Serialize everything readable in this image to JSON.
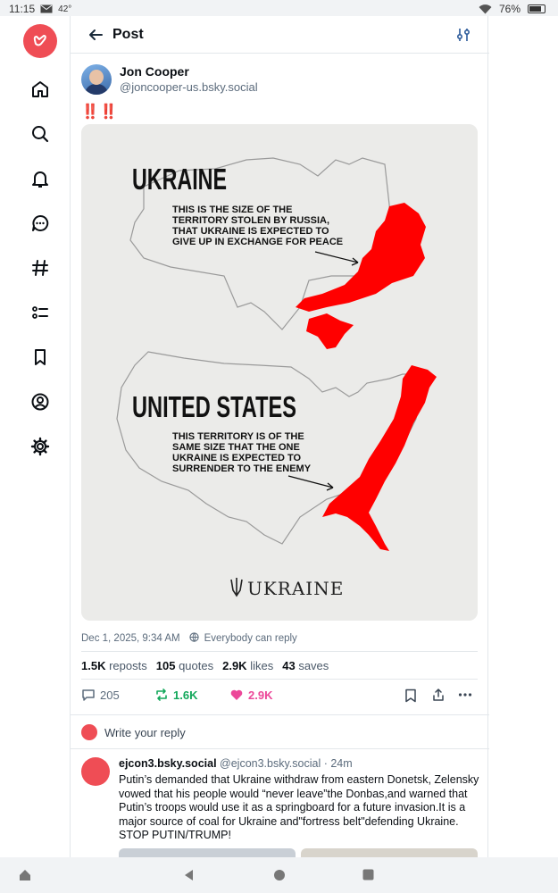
{
  "status_bar": {
    "time": "11:15",
    "temperature": "42°",
    "battery": "76%",
    "icons": [
      "mail-icon",
      "wifi-icon",
      "battery-icon"
    ]
  },
  "rail": {
    "items": [
      "home-icon",
      "search-icon",
      "notifications-icon",
      "chat-icon",
      "feeds-icon",
      "lists-icon",
      "saved-icon",
      "profile-icon",
      "settings-icon"
    ]
  },
  "header": {
    "title": "Post"
  },
  "post": {
    "author_name": "Jon Cooper",
    "author_handle": "@joncooper-us.bsky.social",
    "text": "‼️‼️",
    "image": {
      "heading_1": "UKRAINE",
      "caption_1": [
        "THIS IS THE SIZE OF THE",
        "TERRITORY STOLEN BY RUSSIA,",
        "THAT UKRAINE IS EXPECTED TO",
        "GIVE UP IN EXCHANGE FOR PEACE"
      ],
      "heading_2": "UNITED STATES",
      "caption_2": [
        "THIS TERRITORY IS OF THE",
        "SAME SIZE THAT THE ONE",
        "UKRAINE IS EXPECTED TO",
        "SURRENDER TO THE ENEMY"
      ],
      "logo_text": "UKRAINE",
      "highlight_color": "#ff0000"
    },
    "date": "Dec 1, 2025, 9:34 AM",
    "audience": "Everybody can reply",
    "stats": {
      "reposts_count": "1.5K",
      "reposts_label": "reposts",
      "quotes_count": "105",
      "quotes_label": "quotes",
      "likes_count": "2.9K",
      "likes_label": "likes",
      "saves_count": "43",
      "saves_label": "saves"
    },
    "actions": {
      "replies": "205",
      "reposts": "1.6K",
      "likes": "2.9K"
    }
  },
  "reply_prompt": "Write your reply",
  "comment": {
    "name": "ejcon3.bsky.social",
    "handle": "@ejcon3.bsky.social",
    "time": "· 24m",
    "text": "Putin’s demanded that Ukraine withdraw from eastern Donetsk, Zelensky vowed that his people would “never leave”the Donbas,and warned that Putin’s troops would use it as a springboard for a future invasion.It is a major source of coal for Ukraine and\"fortress belt\"defending Ukraine. STOP PUTIN/TRUMP!"
  },
  "colors": {
    "accent": "#0a7aff",
    "repost_green": "#13a85b",
    "like_pink": "#ec4899",
    "brand": "#ef4d55"
  }
}
